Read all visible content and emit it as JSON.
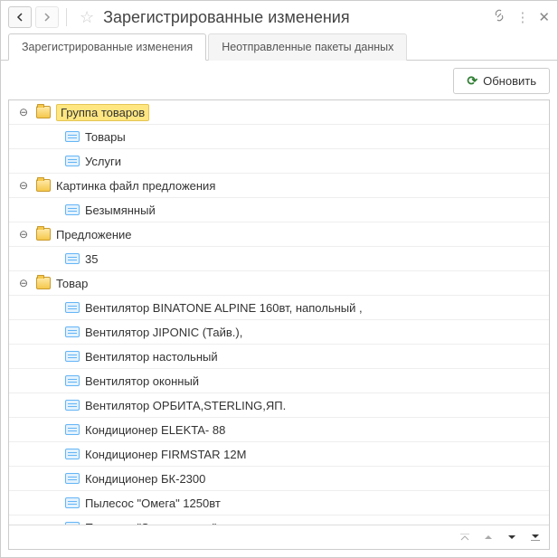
{
  "title": "Зарегистрированные изменения",
  "tabs": [
    {
      "label": "Зарегистрированные изменения",
      "active": true
    },
    {
      "label": "Неотправленные пакеты данных",
      "active": false
    }
  ],
  "toolbar": {
    "refresh_label": "Обновить"
  },
  "tree": [
    {
      "type": "group",
      "label": "Группа товаров",
      "highlighted": true,
      "children": [
        {
          "type": "item",
          "label": "Товары"
        },
        {
          "type": "item",
          "label": "Услуги"
        }
      ]
    },
    {
      "type": "group",
      "label": "Картинка файл предложения",
      "children": [
        {
          "type": "item",
          "label": "Безымянный"
        }
      ]
    },
    {
      "type": "group",
      "label": "Предложение",
      "children": [
        {
          "type": "item",
          "label": "35"
        }
      ]
    },
    {
      "type": "group",
      "label": "Товар",
      "children": [
        {
          "type": "item",
          "label": "Вентилятор BINATONE ALPINE 160вт, напольный ,"
        },
        {
          "type": "item",
          "label": "Вентилятор JIPONIC (Тайв.),"
        },
        {
          "type": "item",
          "label": "Вентилятор настольный"
        },
        {
          "type": "item",
          "label": "Вентилятор оконный"
        },
        {
          "type": "item",
          "label": "Вентилятор ОРБИТА,STERLING,ЯП."
        },
        {
          "type": "item",
          "label": "Кондиционер ELEKTA- 88"
        },
        {
          "type": "item",
          "label": "Кондиционер FIRMSTAR 12M"
        },
        {
          "type": "item",
          "label": "Кондиционер БК-2300"
        },
        {
          "type": "item",
          "label": "Пылесос \"Омега\" 1250вт"
        },
        {
          "type": "item",
          "label": "Пылесос \"Электросила\""
        }
      ]
    }
  ]
}
